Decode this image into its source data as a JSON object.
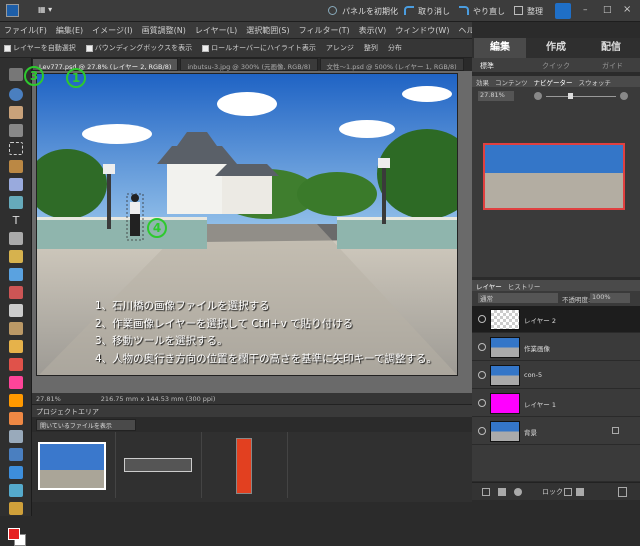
{
  "topbar": {
    "mode_button": "▦ ▾",
    "reset_panels": "パネルを初期化",
    "undo": "取り消し",
    "redo": "やり直し",
    "organize": "整理"
  },
  "menu": [
    "ファイル(F)",
    "編集(E)",
    "イメージ(I)",
    "画質調整(N)",
    "レイヤー(L)",
    "選択範囲(S)",
    "フィルター(T)",
    "表示(V)",
    "ウィンドウ(W)",
    "ヘルプ(H)"
  ],
  "options": [
    "レイヤーを自動選択",
    "バウンディングボックスを表示",
    "ロールオーバーにハイライト表示",
    "アレンジ",
    "整列",
    "分布"
  ],
  "tabs": [
    "Lev777.psd @ 27.8% (レイヤー 2, RGB/8)",
    "inbutsu-3.jpg @ 300% (元画像, RGB/8)",
    "文性〜1.psd @ 500% (レイヤー 1, RGB/8)"
  ],
  "statusbar": {
    "zoom": "27.81%",
    "dims": "216.75 mm x 144.53 mm (300 ppi)"
  },
  "instructions": [
    "1、石川橋の画像ファイルを選択する",
    "2、作業画像レイヤーを選択して Ctrl＋v で貼り付ける",
    "3、移動ツールを選択する。",
    "4、人物の奥行き方向の位置を欄干の高さを基準に矢印キーで調整する。"
  ],
  "markers": {
    "m1": "1",
    "m2": "2",
    "m3": "3",
    "m4": "4"
  },
  "project": {
    "header": "プロジェクトエリア",
    "select": "開いているファイルを表示"
  },
  "right_tabs": {
    "edit": "編集",
    "create": "作成",
    "share": "配信"
  },
  "sub_tabs": {
    "standard": "標準",
    "quick": "クイック",
    "guide": "ガイド"
  },
  "palette_tabs": [
    "効果",
    "コンテンツ",
    "ナビゲーター",
    "スウォッチ"
  ],
  "navigator": {
    "zoom": "27.81%"
  },
  "layer_tabs": [
    "レイヤー",
    "ヒストリー"
  ],
  "layer_controls": {
    "blend": "通常",
    "opacity_label": "不透明度:",
    "opacity": "100%"
  },
  "layers": [
    "レイヤー 2",
    "作業画像",
    "con-5",
    "レイヤー 1",
    "背景"
  ],
  "layer_footer": {
    "lock": "ロック"
  },
  "colors": {
    "accent": "#2ec92e",
    "highlight": "#e04040",
    "magenta": "#ff00ff"
  }
}
